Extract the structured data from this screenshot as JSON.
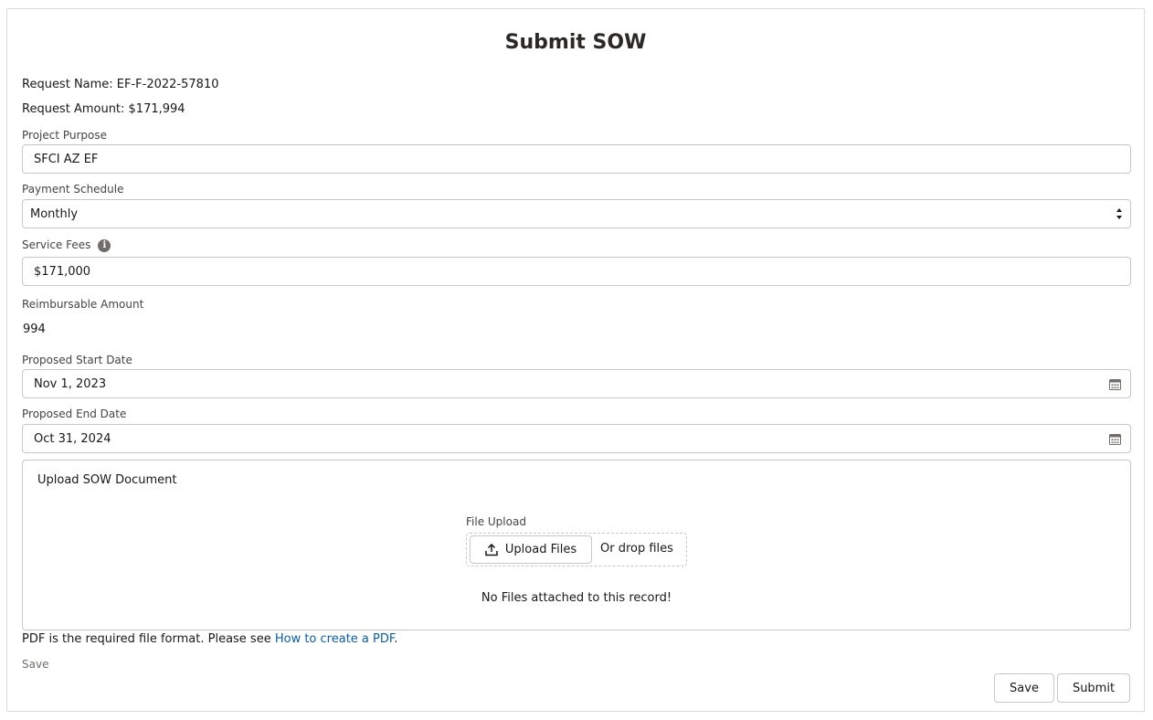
{
  "title": "Submit SOW",
  "request_name": "Request Name: EF-F-2022-57810",
  "request_amount": "Request Amount: $171,994",
  "project_purpose": {
    "label": "Project Purpose",
    "value": "SFCI AZ EF"
  },
  "payment_schedule": {
    "label": "Payment Schedule",
    "value": "Monthly"
  },
  "service_fees": {
    "label": "Service Fees",
    "value": "$171,000",
    "info_icon": "info-icon"
  },
  "reimbursable": {
    "label": "Reimbursable Amount",
    "value": "994"
  },
  "start_date": {
    "label": "Proposed Start Date",
    "value": "Nov 1, 2023",
    "icon": "calendar-icon"
  },
  "end_date": {
    "label": "Proposed End Date",
    "value": "Oct 31, 2024",
    "icon": "calendar-icon"
  },
  "upload": {
    "section_title": "Upload SOW Document",
    "field_label": "File Upload",
    "button_label": "Upload Files",
    "drop_text": "Or drop files",
    "empty_text": "No Files attached to this record!",
    "icon": "upload-icon"
  },
  "pdf_note": {
    "text": "PDF is the required file format. Please see ",
    "link": "How to create a PDF",
    "suffix": "."
  },
  "save_text": "Save",
  "footer": {
    "save_label": "Save",
    "submit_label": "Submit"
  },
  "colors": {
    "link": "#0b5cab",
    "border": "#c9c7c5",
    "label": "#444444"
  }
}
